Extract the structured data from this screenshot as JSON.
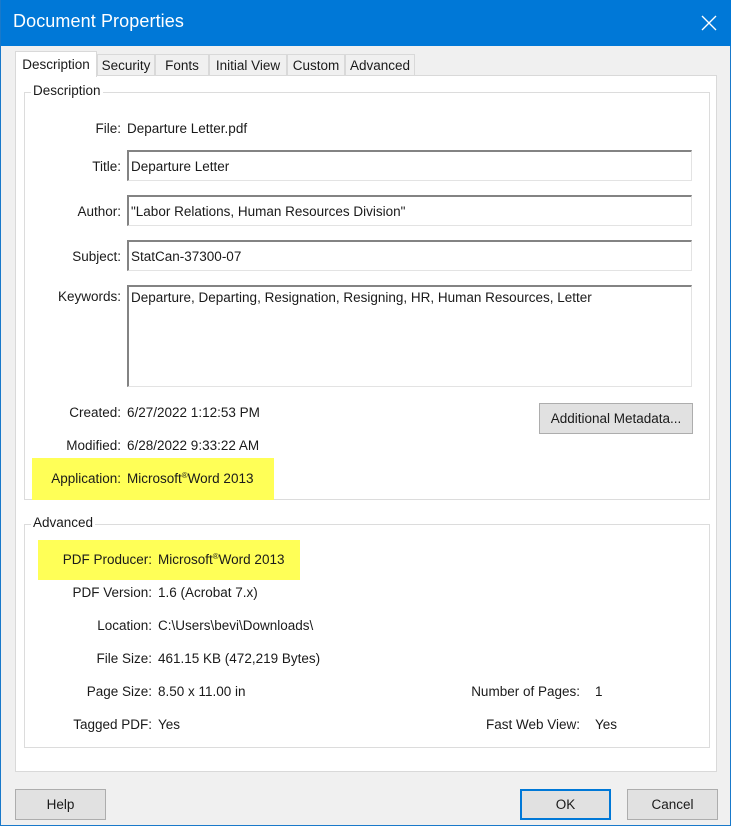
{
  "window": {
    "title": "Document Properties",
    "close_icon": "close-icon"
  },
  "tabs": [
    {
      "label": "Description",
      "active": true
    },
    {
      "label": "Security",
      "active": false
    },
    {
      "label": "Fonts",
      "active": false
    },
    {
      "label": "Initial View",
      "active": false
    },
    {
      "label": "Custom",
      "active": false
    },
    {
      "label": "Advanced",
      "active": false
    }
  ],
  "description": {
    "legend": "Description",
    "file_label": "File:",
    "file_value": "Departure Letter.pdf",
    "title_label": "Title:",
    "title_value": "Departure Letter",
    "author_label": "Author:",
    "author_value": "\"Labor Relations, Human Resources Division\"",
    "subject_label": "Subject:",
    "subject_value": "StatCan-37300-07",
    "keywords_label": "Keywords:",
    "keywords_value": "Departure, Departing, Resignation, Resigning, HR, Human Resources, Letter",
    "created_label": "Created:",
    "created_value": "6/27/2022 1:12:53 PM",
    "modified_label": "Modified:",
    "modified_value": "6/28/2022 9:33:22 AM",
    "application_label": "Application:",
    "application_value_brand": "Microsoft",
    "application_value_mark": "®",
    "application_value_rest": "Word 2013",
    "additional_metadata_button": "Additional Metadata..."
  },
  "advanced": {
    "legend": "Advanced",
    "pdf_producer_label": "PDF Producer:",
    "pdf_producer_brand": "Microsoft",
    "pdf_producer_mark": "®",
    "pdf_producer_rest": "Word 2013",
    "pdf_version_label": "PDF Version:",
    "pdf_version_value": "1.6 (Acrobat 7.x)",
    "location_label": "Location:",
    "location_value": "C:\\Users\\bevi\\Downloads\\",
    "file_size_label": "File Size:",
    "file_size_value": "461.15 KB (472,219 Bytes)",
    "page_size_label": "Page Size:",
    "page_size_value": "8.50 x 11.00 in",
    "num_pages_label": "Number of Pages:",
    "num_pages_value": "1",
    "tagged_pdf_label": "Tagged PDF:",
    "tagged_pdf_value": "Yes",
    "fast_web_view_label": "Fast Web View:",
    "fast_web_view_value": "Yes"
  },
  "footer": {
    "help_button": "Help",
    "ok_button": "OK",
    "cancel_button": "Cancel"
  },
  "colors": {
    "titlebar": "#0078d7",
    "highlight": "#ffff57",
    "default_button_border": "#0078d7"
  }
}
